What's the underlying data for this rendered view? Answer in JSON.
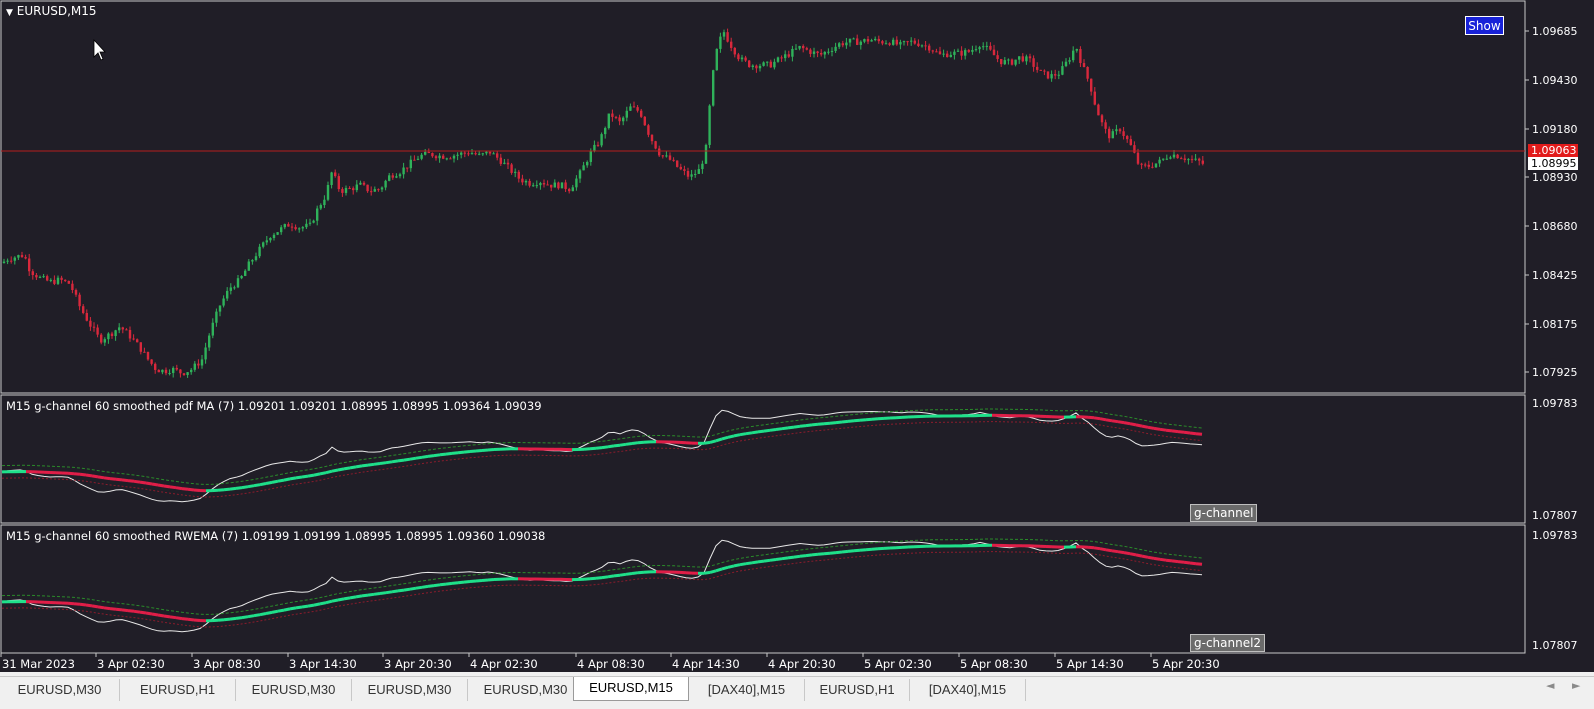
{
  "symbol_title": "EURUSD,M15",
  "show_button": "Show",
  "price_axis": {
    "labels": [
      "1.09685",
      "1.09430",
      "1.09180",
      "1.08930",
      "1.08680",
      "1.08425",
      "1.08175",
      "1.07925"
    ],
    "current_price": "1.09063",
    "bid_price": "1.08995"
  },
  "indicator1": {
    "label": "M15 g-channel  60 smoothed  pdf MA (7) 1.09201 1.09201 1.08995 1.08995 1.09364 1.09039",
    "axis_top": "1.09783",
    "axis_bottom": "1.07807",
    "tag": "g-channel"
  },
  "indicator2": {
    "label": "M15 g-channel  60 smoothed  RWEMA (7) 1.09199 1.09199 1.08995 1.08995 1.09360 1.09038",
    "axis_top": "1.09783",
    "axis_bottom": "1.07807",
    "tag": "g-channel2"
  },
  "time_axis": [
    "31 Mar 2023",
    "3 Apr 02:30",
    "3 Apr 08:30",
    "3 Apr 14:30",
    "3 Apr 20:30",
    "4 Apr 02:30",
    "4 Apr 08:30",
    "4 Apr 14:30",
    "4 Apr 20:30",
    "5 Apr 02:30",
    "5 Apr 08:30",
    "5 Apr 14:30",
    "5 Apr 20:30"
  ],
  "tabs": [
    "EURUSD,M30",
    "EURUSD,H1",
    "EURUSD,M30",
    "EURUSD,M30",
    "EURUSD,M30",
    "EURUSD,M15",
    "[DAX40],M15",
    "EURUSD,H1",
    "[DAX40],M15"
  ],
  "active_tab": 5,
  "colors": {
    "background": "#201e27",
    "bull": "#2fb25a",
    "bear": "#d8283c",
    "channel_up": "#1fe08a",
    "channel_down": "#e01e48",
    "price_line": "#b41e1e"
  },
  "chart_data": {
    "type": "candlestick",
    "title": "EURUSD,M15",
    "ylim": [
      1.0785,
      1.0978
    ],
    "x_tick_labels": [
      "31 Mar 2023",
      "3 Apr 02:30",
      "3 Apr 08:30",
      "3 Apr 14:30",
      "3 Apr 20:30",
      "4 Apr 02:30",
      "4 Apr 08:30",
      "4 Apr 14:30",
      "4 Apr 20:30",
      "5 Apr 02:30",
      "5 Apr 08:30",
      "5 Apr 14:30",
      "5 Apr 20:30"
    ],
    "y_tick_labels": [
      "1.09685",
      "1.09430",
      "1.09180",
      "1.08930",
      "1.08680",
      "1.08425",
      "1.08175",
      "1.07925"
    ],
    "close_series": [
      [
        0,
        1.0848
      ],
      [
        8,
        1.0851
      ],
      [
        16,
        1.0852
      ],
      [
        24,
        1.0853
      ],
      [
        30,
        1.0845
      ],
      [
        40,
        1.0841
      ],
      [
        50,
        1.0839
      ],
      [
        60,
        1.084
      ],
      [
        70,
        1.0838
      ],
      [
        80,
        1.0826
      ],
      [
        90,
        1.0817
      ],
      [
        100,
        1.0809
      ],
      [
        110,
        1.0812
      ],
      [
        120,
        1.0816
      ],
      [
        130,
        1.0811
      ],
      [
        140,
        1.0805
      ],
      [
        148,
        1.0799
      ],
      [
        156,
        1.0794
      ],
      [
        164,
        1.0793
      ],
      [
        172,
        1.0794
      ],
      [
        182,
        1.0792
      ],
      [
        192,
        1.0794
      ],
      [
        202,
        1.0799
      ],
      [
        210,
        1.0813
      ],
      [
        220,
        1.0827
      ],
      [
        230,
        1.0836
      ],
      [
        240,
        1.084
      ],
      [
        250,
        1.0849
      ],
      [
        260,
        1.0856
      ],
      [
        270,
        1.0863
      ],
      [
        280,
        1.0866
      ],
      [
        290,
        1.0869
      ],
      [
        300,
        1.0867
      ],
      [
        310,
        1.0868
      ],
      [
        318,
        1.0877
      ],
      [
        326,
        1.0884
      ],
      [
        332,
        1.0896
      ],
      [
        340,
        1.0886
      ],
      [
        350,
        1.0887
      ],
      [
        360,
        1.0889
      ],
      [
        370,
        1.0886
      ],
      [
        380,
        1.0887
      ],
      [
        390,
        1.0894
      ],
      [
        400,
        1.0896
      ],
      [
        410,
        1.09
      ],
      [
        420,
        1.0904
      ],
      [
        430,
        1.0905
      ],
      [
        440,
        1.0904
      ],
      [
        450,
        1.0904
      ],
      [
        460,
        1.0905
      ],
      [
        470,
        1.0906
      ],
      [
        480,
        1.0904
      ],
      [
        490,
        1.0906
      ],
      [
        500,
        1.0902
      ],
      [
        510,
        1.0897
      ],
      [
        520,
        1.0892
      ],
      [
        530,
        1.089
      ],
      [
        540,
        1.0891
      ],
      [
        550,
        1.0889
      ],
      [
        560,
        1.0889
      ],
      [
        570,
        1.0887
      ],
      [
        580,
        1.0895
      ],
      [
        590,
        1.0905
      ],
      [
        600,
        1.0912
      ],
      [
        610,
        1.0926
      ],
      [
        620,
        1.0921
      ],
      [
        630,
        1.0929
      ],
      [
        640,
        1.0927
      ],
      [
        650,
        1.0914
      ],
      [
        660,
        1.0905
      ],
      [
        670,
        1.0902
      ],
      [
        680,
        1.0897
      ],
      [
        690,
        1.0893
      ],
      [
        700,
        1.0897
      ],
      [
        706,
        1.0908
      ],
      [
        712,
        1.0943
      ],
      [
        718,
        1.0962
      ],
      [
        724,
        1.0968
      ],
      [
        730,
        1.0962
      ],
      [
        740,
        1.0954
      ],
      [
        750,
        1.0951
      ],
      [
        760,
        1.0951
      ],
      [
        770,
        1.0951
      ],
      [
        780,
        1.0954
      ],
      [
        790,
        1.0957
      ],
      [
        800,
        1.096
      ],
      [
        810,
        1.0958
      ],
      [
        820,
        1.0956
      ],
      [
        830,
        1.0959
      ],
      [
        840,
        1.0962
      ],
      [
        850,
        1.0963
      ],
      [
        860,
        1.0963
      ],
      [
        870,
        1.0964
      ],
      [
        880,
        1.0963
      ],
      [
        890,
        1.0963
      ],
      [
        900,
        1.0961
      ],
      [
        910,
        1.0963
      ],
      [
        920,
        1.0962
      ],
      [
        930,
        1.096
      ],
      [
        940,
        1.0956
      ],
      [
        950,
        1.0957
      ],
      [
        960,
        1.0957
      ],
      [
        970,
        1.0958
      ],
      [
        980,
        1.0962
      ],
      [
        990,
        1.0958
      ],
      [
        1000,
        1.0953
      ],
      [
        1010,
        1.0952
      ],
      [
        1020,
        1.0955
      ],
      [
        1030,
        1.0953
      ],
      [
        1040,
        1.0947
      ],
      [
        1050,
        1.0945
      ],
      [
        1060,
        1.0947
      ],
      [
        1070,
        1.0955
      ],
      [
        1076,
        1.0961
      ],
      [
        1082,
        1.0951
      ],
      [
        1090,
        1.0941
      ],
      [
        1096,
        1.0929
      ],
      [
        1104,
        1.0918
      ],
      [
        1110,
        1.0914
      ],
      [
        1120,
        1.0918
      ],
      [
        1130,
        1.091
      ],
      [
        1140,
        1.0898
      ],
      [
        1150,
        1.0899
      ],
      [
        1160,
        1.0901
      ],
      [
        1170,
        1.0905
      ],
      [
        1180,
        1.0904
      ],
      [
        1190,
        1.0902
      ],
      [
        1200,
        1.0901
      ],
      [
        1206,
        1.0899
      ]
    ]
  }
}
